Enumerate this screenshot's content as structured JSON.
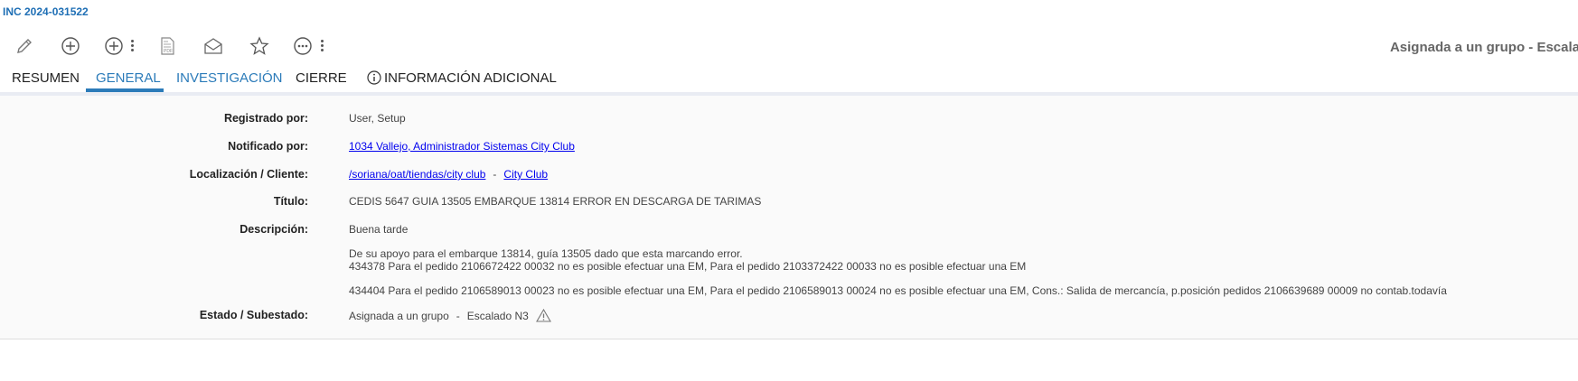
{
  "header": {
    "incident_id": "INC 2024-031522",
    "status_title": "Asignada a un grupo - Escala"
  },
  "toolbar": {
    "items": [
      {
        "icon": "pencil-icon"
      },
      {
        "icon": "plus-circle-icon"
      },
      {
        "icon": "plus-circle-menu-icon"
      },
      {
        "icon": "pdf-icon"
      },
      {
        "icon": "envelope-icon"
      },
      {
        "icon": "star-icon"
      },
      {
        "icon": "more-circle-icon"
      }
    ]
  },
  "tabs": [
    {
      "label": "RESUMEN"
    },
    {
      "label": "GENERAL"
    },
    {
      "label": "INVESTIGACIÓN"
    },
    {
      "label": "CIERRE"
    },
    {
      "label": "INFORMACIÓN ADICIONAL"
    }
  ],
  "fields": {
    "registrado": {
      "label": "Registrado por:",
      "value": "User, Setup"
    },
    "notificado": {
      "label": "Notificado por:",
      "value": "1034 Vallejo, Administrador Sistemas City Club"
    },
    "localizacion": {
      "label": "Localización / Cliente:",
      "value": "/soriana/oat/tiendas/city club",
      "separator": "-",
      "client": "City Club"
    },
    "titulo": {
      "label": "Título:",
      "value": "CEDIS 5647 GUIA 13505 EMBARQUE 13814 ERROR EN DESCARGA DE TARIMAS"
    },
    "descripcion": {
      "label": "Descripción:",
      "lines": [
        "Buena tarde",
        "De su apoyo para el embarque 13814, guía 13505 dado que esta marcando error.",
        "434378 Para el pedido 2106672422 00032 no es posible efectuar una EM, Para el pedido 2103372422 00033 no es posible efectuar una EM",
        "434404 Para el pedido 2106589013 00023 no es posible efectuar una EM, Para el pedido  2106589013 00024 no es posible efectuar una EM, Cons.: Salida de mercancía, p.posición pedidos 2106639689 00009 no contab.todavía"
      ]
    },
    "estado": {
      "label": "Estado / Subestado:",
      "estado": "Asignada a un grupo",
      "separator": "-",
      "subestado": "Escalado N3"
    }
  },
  "colors": {
    "accent": "#2b7bb9",
    "link": "#0000ee",
    "label": "#222222"
  }
}
